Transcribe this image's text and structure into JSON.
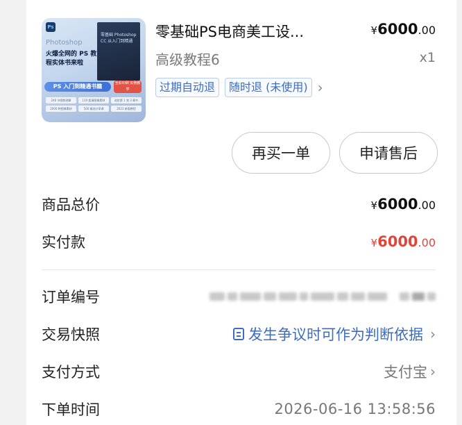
{
  "product": {
    "thumbnail": {
      "brand": "Photoshop",
      "headline": "火爆全网的 PS 教程实体书来啦",
      "book_text": "零基础 Photoshop CC 从入门到精通",
      "banner": "PS 入门到精通书籍",
      "chip": "全彩印刷 实例教学",
      "features": [
        "240 节视频讲解",
        "110 超清图像素材",
        "进阶第 1 到 3 章节",
        "2000 种图像素材",
        "500 精选分享课",
        "2023 新版教程"
      ]
    },
    "title": "零基础PS电商美工设...",
    "subtitle": "高级教程6",
    "price_symbol": "¥",
    "price_int": "6000",
    "price_dec": ".00",
    "quantity": "x1",
    "tags": [
      "过期自动退",
      "随时退 (未使用)"
    ]
  },
  "actions": {
    "rebuy_label": "再买一单",
    "after_sale_label": "申请售后"
  },
  "summary": {
    "total_label": "商品总价",
    "total_symbol": "¥",
    "total_int": "6000",
    "total_dec": ".00",
    "paid_label": "实付款",
    "paid_symbol": "¥",
    "paid_int": "6000",
    "paid_dec": ".00"
  },
  "details": {
    "order_no_label": "订单编号",
    "snapshot_label": "交易快照",
    "snapshot_value": "发生争议时可作为判断依据",
    "payment_label": "支付方式",
    "payment_value": "支付宝",
    "time_label": "下单时间",
    "time_value": "2026-06-16 13:58:56"
  },
  "colors": {
    "accent_blue": "#3d6cc0",
    "price_red": "#e0453a"
  },
  "icons": {
    "snapshot": "document-icon",
    "more": "chevron-right-icon"
  }
}
